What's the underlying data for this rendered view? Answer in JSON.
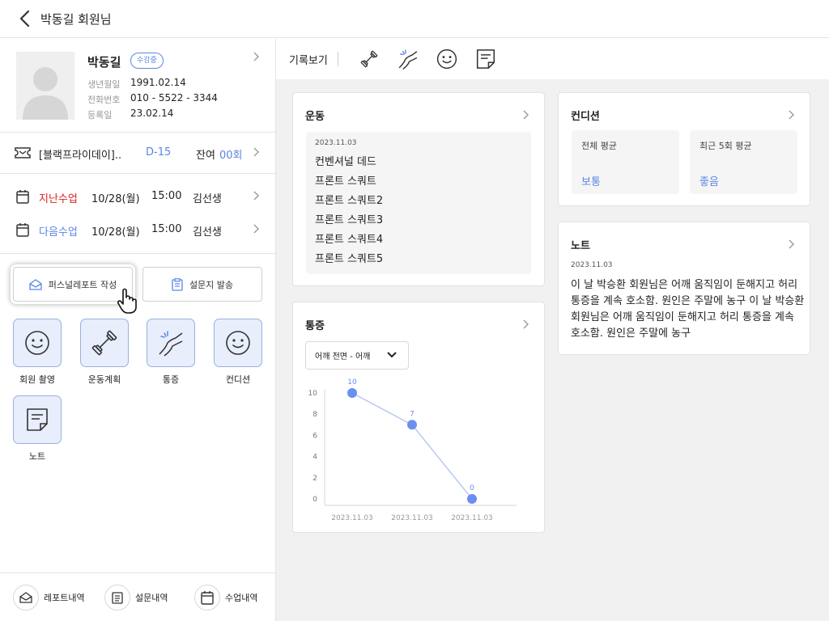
{
  "topbar": {
    "title": "박동길 회원님"
  },
  "member": {
    "name": "박동길",
    "status": "수강중",
    "birth_label": "생년월일",
    "birth": "1991.02.14",
    "phone_label": "전화번호",
    "phone": "010 - 5522 - 3344",
    "reg_label": "등록일",
    "reg": "23.02.14"
  },
  "ticket": {
    "name": "[블랙프라이데이]..",
    "dday": "D-15",
    "remain_label": "잔여",
    "remain": "00회"
  },
  "lessons": {
    "prev": {
      "label": "지난수업",
      "date": "10/28(월)",
      "time": "15:00",
      "teacher": "김선생",
      "color": "#e02020"
    },
    "next": {
      "label": "다음수업",
      "date": "10/28(월)",
      "time": "15:00",
      "teacher": "김선생",
      "color": "#5b86e5"
    }
  },
  "actions": {
    "report": "퍼스널레포트 작성",
    "survey": "설문지 발송"
  },
  "tiles": [
    {
      "label": "회원 촬영",
      "icon": "smile-icon"
    },
    {
      "label": "운동계획",
      "icon": "dumbbell-icon"
    },
    {
      "label": "통증",
      "icon": "pain-icon"
    },
    {
      "label": "컨디션",
      "icon": "smile-icon"
    },
    {
      "label": "노트",
      "icon": "note-icon"
    }
  ],
  "bottom": {
    "reports": "레포트내역",
    "surveys": "설문내역",
    "lessons": "수업내역"
  },
  "toolbar": {
    "label": "기록보기"
  },
  "exercise": {
    "title": "운동",
    "date": "2023.11.03",
    "items": [
      "컨벤셔널 데드",
      "프론트 스쿼트",
      "프론트 스쿼트2",
      "프론트 스쿼트3",
      "프론트 스쿼트4",
      "프론트 스쿼트5"
    ]
  },
  "condition": {
    "title": "컨디션",
    "overall_label": "전체 평균",
    "overall_value": "보통",
    "recent_label": "최근 5회 평균",
    "recent_value": "좋음"
  },
  "note": {
    "title": "노트",
    "date": "2023.11.03",
    "body": "이 날 박승환 회원님은 어깨 움직임이 둔해지고 허리 통증을 계속 호소함. 원인은 주말에 농구 이 날 박승환 회원님은 어깨 움직임이 둔해지고 허리 통증을 계속 호소함. 원인은 주말에 농구"
  },
  "pain": {
    "title": "통증",
    "selected": "어깨 전면 - 어깨"
  },
  "chart_data": {
    "type": "line",
    "x": [
      "2023.11.03",
      "2023.11.03",
      "2023.11.03"
    ],
    "series": [
      {
        "values": [
          10,
          7,
          0
        ]
      }
    ],
    "ylim": [
      0,
      10
    ],
    "yticks": [
      0,
      2,
      4,
      6,
      8,
      10
    ],
    "color": "#6b8ef0",
    "line_color": "#b7c9f3"
  }
}
